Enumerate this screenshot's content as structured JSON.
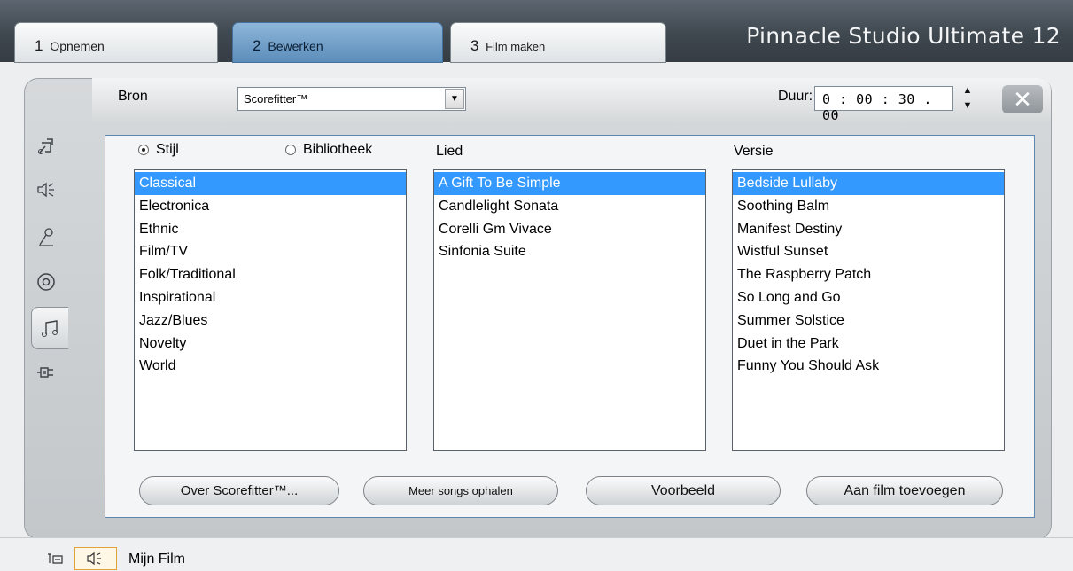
{
  "app": {
    "brand": "Pinnacle Studio Ultimate 12"
  },
  "tabs": [
    {
      "num": "1",
      "label": "Opnemen"
    },
    {
      "num": "2",
      "label": "Bewerken"
    },
    {
      "num": "3",
      "label": "Film maken"
    }
  ],
  "header": {
    "bron_label": "Bron",
    "bron_value": "Scorefitter™",
    "duur_label": "Duur:",
    "duur_value": "0 : 00 : 30 . 00",
    "close_glyph": "✕"
  },
  "rail_icons": [
    "titles-icon",
    "sound-icon",
    "voiceover-icon",
    "disc-icon",
    "music-icon",
    "plugin-icon"
  ],
  "source_options": {
    "style_label": "Stijl",
    "library_label": "Bibliotheek",
    "selected": "Stijl"
  },
  "columns": {
    "song_label": "Lied",
    "version_label": "Versie"
  },
  "style_list": [
    "Classical",
    "Electronica",
    "Ethnic",
    "Film/TV",
    "Folk/Traditional",
    "Inspirational",
    "Jazz/Blues",
    "Novelty",
    "World"
  ],
  "style_selected": 0,
  "song_list": [
    "A Gift To Be Simple",
    "Candlelight Sonata",
    "Corelli Gm Vivace",
    "Sinfonia Suite"
  ],
  "song_selected": 0,
  "version_list": [
    "Bedside Lullaby",
    "Soothing Balm",
    "Manifest Destiny",
    "Wistful Sunset",
    "The Raspberry Patch",
    "So Long and Go",
    "Summer Solstice",
    "Duet in the Park",
    "Funny You Should Ask"
  ],
  "version_selected": 0,
  "buttons": {
    "about": "Over Scorefitter™...",
    "more_songs": "Meer songs ophalen",
    "preview": "Voorbeeld",
    "add_to_movie": "Aan film toevoegen"
  },
  "footer": {
    "title": "Mijn Film"
  },
  "colors": {
    "selection": "#3399ff",
    "active_tab": "#6f9cc7",
    "content_border": "#5d87b0"
  }
}
